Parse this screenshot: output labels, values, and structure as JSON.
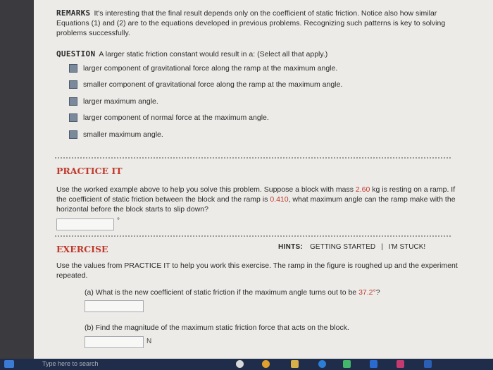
{
  "remarks": {
    "label": "REMARKS",
    "text": "It's interesting that the final result depends only on the coefficient of static friction. Notice also how similar Equations (1) and (2) are to the equations developed in previous problems. Recognizing such patterns is key to solving problems successfully."
  },
  "question": {
    "label": "QUESTION",
    "text": "A larger static friction constant would result in a: (Select all that apply.)",
    "options": [
      "larger component of gravitational force along the ramp at the maximum angle.",
      "smaller component of gravitational force along the ramp at the maximum angle.",
      "larger maximum angle.",
      "larger component of normal force at the maximum angle.",
      "smaller maximum angle."
    ]
  },
  "practice": {
    "heading": "PRACTICE IT",
    "text_1": "Use the worked example above to help you solve this problem. Suppose a block with mass ",
    "mass": "2.60",
    "text_2": " kg is resting on a ramp. If the coefficient of static friction between the block and the ramp is ",
    "mu": "0.410",
    "text_3": ", what maximum angle can the ramp make with the horizontal before the block starts to slip down?",
    "answer_unit": "°"
  },
  "exercise": {
    "heading": "EXERCISE",
    "hints_label": "HINTS:",
    "getting_started": "GETTING STARTED",
    "separator": "|",
    "stuck": "I'M STUCK!",
    "intro": "Use the values from PRACTICE IT to help you work this exercise. The ramp in the figure is roughed up and the experiment repeated.",
    "part_a_text": "(a) What is the new coefficient of static friction if the maximum angle turns out to be ",
    "part_a_angle": "37.2°",
    "part_a_end": "?",
    "part_b": "(b) Find the magnitude of the maximum static friction force that acts on the block.",
    "part_b_unit": "N"
  },
  "taskbar": {
    "search_placeholder": "Type here to search"
  }
}
